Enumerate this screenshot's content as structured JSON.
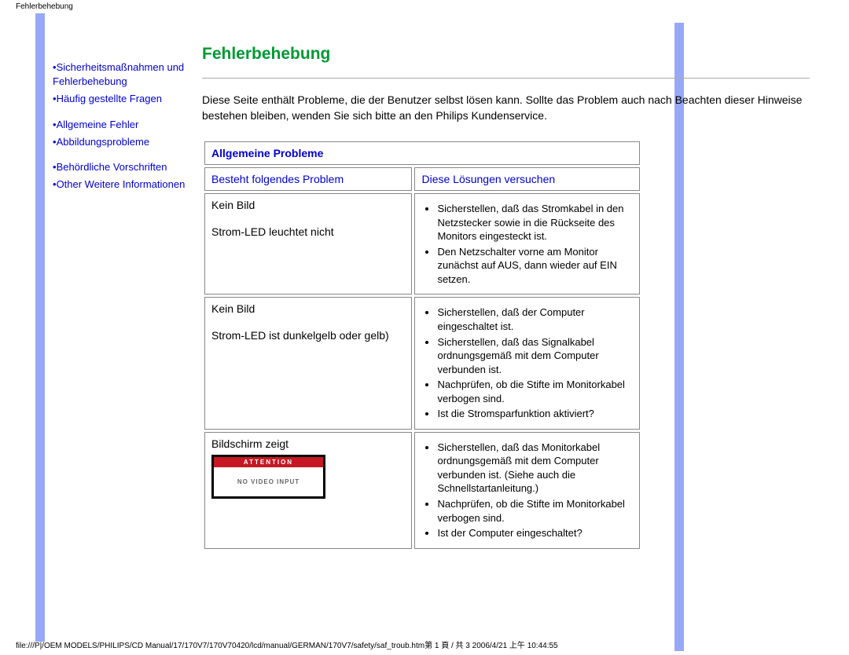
{
  "header": {
    "label": "Fehlerbehebung"
  },
  "sidebar": {
    "links": [
      {
        "text": "Sicherheitsmaßnahmen und Fehlerbehebung"
      },
      {
        "text": "Häufig gestellte Fragen"
      },
      {
        "text": "Allgemeine Fehler"
      },
      {
        "text": "Abbildungsprobleme"
      },
      {
        "text": "Behördliche Vorschriften"
      },
      {
        "text": "Other Weitere Informationen"
      }
    ]
  },
  "main": {
    "title": "Fehlerbehebung",
    "intro": "Diese Seite enthält Probleme, die der Benutzer selbst lösen kann. Sollte das Problem auch nach Beachten dieser Hinweise bestehen bleiben, wenden Sie sich bitte an den Philips Kundenservice.",
    "section_header": "Allgemeine Probleme",
    "col1_header": "Besteht folgendes Problem",
    "col2_header": "Diese Lösungen versuchen",
    "rows": [
      {
        "problem_line1": "Kein Bild",
        "problem_line2": "Strom-LED leuchtet nicht",
        "solutions": [
          "Sicherstellen, daß das Stromkabel in den Netzstecker sowie in die Rückseite des Monitors eingesteckt ist.",
          "Den Netzschalter vorne am Monitor zunächst auf AUS, dann wieder auf EIN setzen."
        ]
      },
      {
        "problem_line1": "Kein Bild",
        "problem_line2": "Strom-LED ist dunkelgelb oder gelb)",
        "solutions": [
          "Sicherstellen, daß der Computer eingeschaltet ist.",
          "Sicherstellen, daß das Signalkabel ordnungsgemäß mit dem Computer verbunden ist.",
          "Nachprüfen, ob die Stifte im Monitorkabel verbogen sind.",
          "Ist die Stromsparfunktion aktiviert?"
        ]
      },
      {
        "problem_line1": "Bildschirm zeigt",
        "screen_attention": "ATTENTION",
        "screen_msg": "NO VIDEO INPUT",
        "solutions": [
          "Sicherstellen, daß das Monitorkabel ordnungsgemäß mit dem Computer verbunden ist. (Siehe auch die Schnellstartanleitung.)",
          "Nachprüfen, ob die Stifte im Monitorkabel verbogen sind.",
          "Ist der Computer eingeschaltet?"
        ]
      }
    ]
  },
  "footer": {
    "path": "file:///P|/OEM MODELS/PHILIPS/CD Manual/17/170V7/170V70420/lcd/manual/GERMAN/170V7/safety/saf_troub.htm第 1 頁 / 共 3 2006/4/21 上午 10:44:55"
  }
}
